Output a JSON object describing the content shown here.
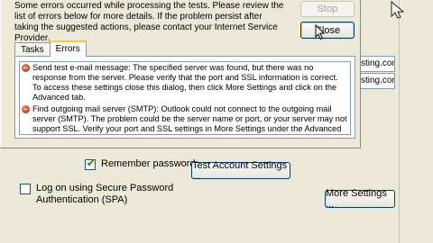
{
  "dialog": {
    "message": "Some errors occurred while processing the tests. Please review the list of errors below for more details. If the problem persist after taking the suggested actions, please contact your Internet Service Provider.",
    "stop_label": "Stop",
    "close_label": "Close",
    "tabs": [
      {
        "label": "Tasks",
        "active": false
      },
      {
        "label": "Errors",
        "active": true
      }
    ],
    "errors": [
      "Send test e-mail message: The specified server was found, but there was no response from the server. Please verify that the port and SSL information is correct. To access these settings close this dialog, then click More Settings and click on the Advanced tab.",
      "Find outgoing mail server (SMTP): Outlook could not connect to the outgoing mail server (SMTP). The problem could be the server name or port, or your server may not support SSL. Verify your port and SSL settings in More Settings under the Advanced tab."
    ]
  },
  "account_window": {
    "field_1_value": "sting.com",
    "field_2_value": "sting.com",
    "remember_password_label": "Remember password",
    "remember_password_checked": true,
    "spa_label": "Log on using Secure Password Authentication (SPA)",
    "spa_checked": false,
    "test_settings_label": "Test Account Settings ...",
    "more_settings_label": "More Settings ..."
  },
  "colors": {
    "window_bg": "#ece9d8",
    "button_border": "#003c74",
    "focus_ring": "#ffc95d",
    "error_icon": "#b21b06"
  }
}
